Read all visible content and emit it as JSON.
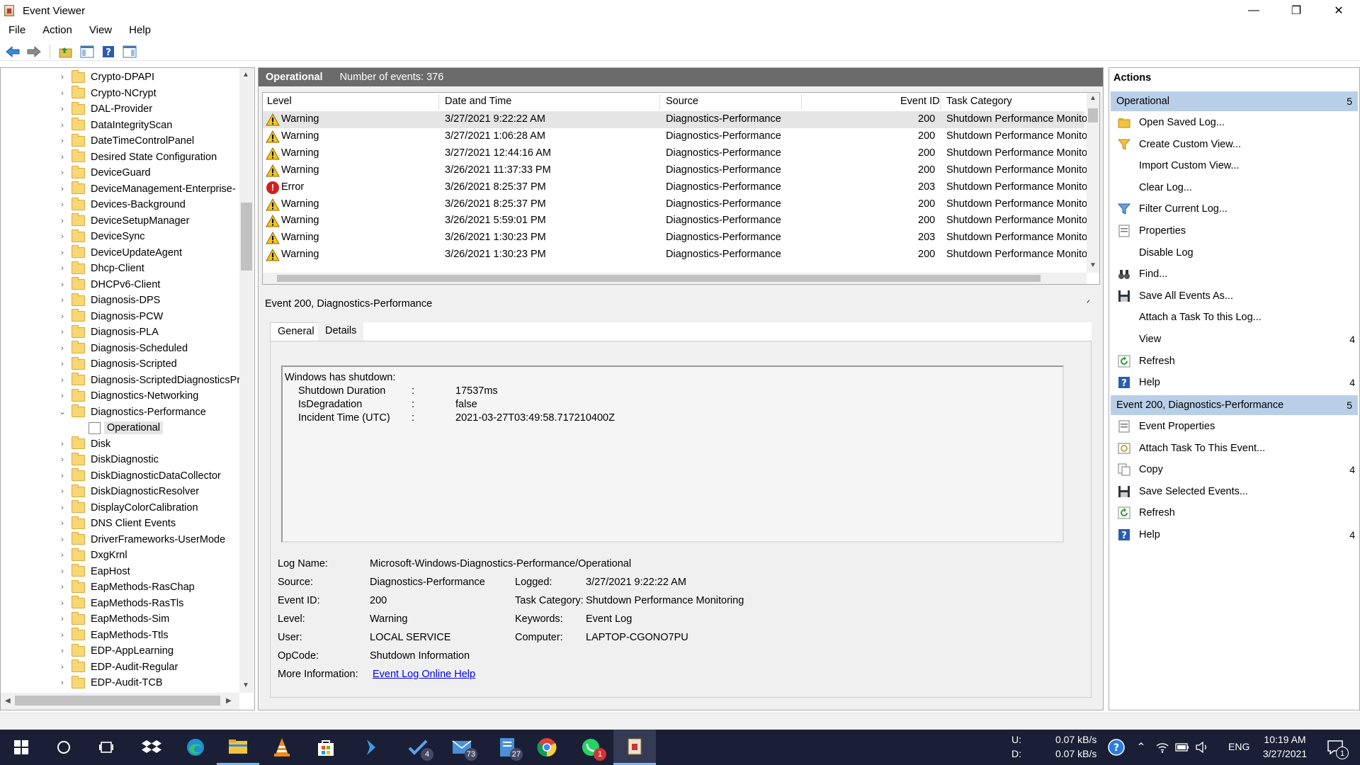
{
  "window": {
    "title": "Event Viewer",
    "minimize": "—",
    "restore": "❐",
    "close": "✕"
  },
  "menu": [
    "File",
    "Action",
    "View",
    "Help"
  ],
  "tree": {
    "items": [
      {
        "label": "Crypto-DPAPI",
        "expand": "›"
      },
      {
        "label": "Crypto-NCrypt",
        "expand": "›"
      },
      {
        "label": "DAL-Provider",
        "expand": "›"
      },
      {
        "label": "DataIntegrityScan",
        "expand": "›"
      },
      {
        "label": "DateTimeControlPanel",
        "expand": "›"
      },
      {
        "label": "Desired State Configuration",
        "expand": "›"
      },
      {
        "label": "DeviceGuard",
        "expand": "›"
      },
      {
        "label": "DeviceManagement-Enterprise-",
        "expand": "›"
      },
      {
        "label": "Devices-Background",
        "expand": "›"
      },
      {
        "label": "DeviceSetupManager",
        "expand": "›"
      },
      {
        "label": "DeviceSync",
        "expand": "›"
      },
      {
        "label": "DeviceUpdateAgent",
        "expand": "›"
      },
      {
        "label": "Dhcp-Client",
        "expand": "›"
      },
      {
        "label": "DHCPv6-Client",
        "expand": "›"
      },
      {
        "label": "Diagnosis-DPS",
        "expand": "›"
      },
      {
        "label": "Diagnosis-PCW",
        "expand": "›"
      },
      {
        "label": "Diagnosis-PLA",
        "expand": "›"
      },
      {
        "label": "Diagnosis-Scheduled",
        "expand": "›"
      },
      {
        "label": "Diagnosis-Scripted",
        "expand": "›"
      },
      {
        "label": "Diagnosis-ScriptedDiagnosticsPr",
        "expand": "›"
      },
      {
        "label": "Diagnostics-Networking",
        "expand": "›"
      },
      {
        "label": "Diagnostics-Performance",
        "expand": "⌄"
      },
      {
        "label": "Operational",
        "expand": ""
      },
      {
        "label": "Disk",
        "expand": "›"
      },
      {
        "label": "DiskDiagnostic",
        "expand": "›"
      },
      {
        "label": "DiskDiagnosticDataCollector",
        "expand": "›"
      },
      {
        "label": "DiskDiagnosticResolver",
        "expand": "›"
      },
      {
        "label": "DisplayColorCalibration",
        "expand": "›"
      },
      {
        "label": "DNS Client Events",
        "expand": "›"
      },
      {
        "label": "DriverFrameworks-UserMode",
        "expand": "›"
      },
      {
        "label": "DxgKrnl",
        "expand": "›"
      },
      {
        "label": "EapHost",
        "expand": "›"
      },
      {
        "label": "EapMethods-RasChap",
        "expand": "›"
      },
      {
        "label": "EapMethods-RasTls",
        "expand": "›"
      },
      {
        "label": "EapMethods-Sim",
        "expand": "›"
      },
      {
        "label": "EapMethods-Ttls",
        "expand": "›"
      },
      {
        "label": "EDP-AppLearning",
        "expand": "›"
      },
      {
        "label": "EDP-Audit-Regular",
        "expand": "›"
      },
      {
        "label": "EDP-Audit-TCB",
        "expand": "›"
      }
    ]
  },
  "log": {
    "name": "Operational",
    "count_text": "Number of events: 376"
  },
  "columns": {
    "level": "Level",
    "datetime": "Date and Time",
    "source": "Source",
    "eventid": "Event ID",
    "category": "Task Category"
  },
  "events": [
    {
      "level": "Warning",
      "icon": "warning-icon",
      "datetime": "3/27/2021 9:22:22 AM",
      "source": "Diagnostics-Performance",
      "eventid": "200",
      "category": "Shutdown Performance Monito"
    },
    {
      "level": "Warning",
      "icon": "warning-icon",
      "datetime": "3/27/2021 1:06:28 AM",
      "source": "Diagnostics-Performance",
      "eventid": "200",
      "category": "Shutdown Performance Monito"
    },
    {
      "level": "Warning",
      "icon": "warning-icon",
      "datetime": "3/27/2021 12:44:16 AM",
      "source": "Diagnostics-Performance",
      "eventid": "200",
      "category": "Shutdown Performance Monito"
    },
    {
      "level": "Warning",
      "icon": "warning-icon",
      "datetime": "3/26/2021 11:37:33 PM",
      "source": "Diagnostics-Performance",
      "eventid": "200",
      "category": "Shutdown Performance Monito"
    },
    {
      "level": "Error",
      "icon": "error-icon",
      "datetime": "3/26/2021 8:25:37 PM",
      "source": "Diagnostics-Performance",
      "eventid": "203",
      "category": "Shutdown Performance Monito"
    },
    {
      "level": "Warning",
      "icon": "warning-icon",
      "datetime": "3/26/2021 8:25:37 PM",
      "source": "Diagnostics-Performance",
      "eventid": "200",
      "category": "Shutdown Performance Monito"
    },
    {
      "level": "Warning",
      "icon": "warning-icon",
      "datetime": "3/26/2021 5:59:01 PM",
      "source": "Diagnostics-Performance",
      "eventid": "200",
      "category": "Shutdown Performance Monito"
    },
    {
      "level": "Warning",
      "icon": "warning-icon",
      "datetime": "3/26/2021 1:30:23 PM",
      "source": "Diagnostics-Performance",
      "eventid": "203",
      "category": "Shutdown Performance Monito"
    },
    {
      "level": "Warning",
      "icon": "warning-icon",
      "datetime": "3/26/2021 1:30:23 PM",
      "source": "Diagnostics-Performance",
      "eventid": "200",
      "category": "Shutdown Performance Monito"
    }
  ],
  "detail": {
    "title": "Event 200, Diagnostics-Performance",
    "tabs": [
      "General",
      "Details"
    ],
    "description": {
      "heading": "Windows has shutdown:",
      "rows": [
        {
          "key": "Shutdown Duration",
          "sep": ":",
          "value": "17537ms"
        },
        {
          "key": "IsDegradation",
          "sep": ":",
          "value": "false"
        },
        {
          "key": "Incident Time (UTC)",
          "sep": ":",
          "value": "2021-03-27T03:49:58.717210400Z"
        }
      ]
    },
    "props": {
      "log_name_label": "Log Name:",
      "log_name": "Microsoft-Windows-Diagnostics-Performance/Operational",
      "source_label": "Source:",
      "source": "Diagnostics-Performance",
      "logged_label": "Logged:",
      "logged": "3/27/2021 9:22:22 AM",
      "event_id_label": "Event ID:",
      "event_id": "200",
      "task_category_label": "Task Category:",
      "task_category": "Shutdown Performance Monitoring",
      "level_label": "Level:",
      "level": "Warning",
      "keywords_label": "Keywords:",
      "keywords": "Event Log",
      "user_label": "User:",
      "user": "LOCAL SERVICE",
      "computer_label": "Computer:",
      "computer": "LAPTOP-CGONO7PU",
      "opcode_label": "OpCode:",
      "opcode": "Shutdown Information",
      "more_info_label": "More Information:",
      "more_info_link": "Event Log Online Help"
    }
  },
  "actions": {
    "title": "Actions",
    "section1": {
      "label": "Operational",
      "arrow": "5"
    },
    "items1": [
      {
        "label": "Open Saved Log...",
        "icon": "folder-open-icon",
        "arrow": ""
      },
      {
        "label": "Create Custom View...",
        "icon": "funnel-star-icon",
        "arrow": ""
      },
      {
        "label": "Import Custom View...",
        "icon": "",
        "arrow": ""
      },
      {
        "label": "Clear Log...",
        "icon": "",
        "arrow": ""
      },
      {
        "label": "Filter Current Log...",
        "icon": "funnel-icon",
        "arrow": ""
      },
      {
        "label": "Properties",
        "icon": "properties-icon",
        "arrow": ""
      },
      {
        "label": "Disable Log",
        "icon": "",
        "arrow": ""
      },
      {
        "label": "Find...",
        "icon": "binoculars-icon",
        "arrow": ""
      },
      {
        "label": "Save All Events As...",
        "icon": "save-icon",
        "arrow": ""
      },
      {
        "label": "Attach a Task To this Log...",
        "icon": "",
        "arrow": ""
      },
      {
        "label": "View",
        "icon": "",
        "arrow": "4"
      },
      {
        "label": "Refresh",
        "icon": "refresh-icon",
        "arrow": ""
      },
      {
        "label": "Help",
        "icon": "help-icon",
        "arrow": "4"
      }
    ],
    "section2": {
      "label": "Event 200, Diagnostics-Performance",
      "arrow": "5"
    },
    "items2": [
      {
        "label": "Event Properties",
        "icon": "event-properties-icon",
        "arrow": ""
      },
      {
        "label": "Attach Task To This Event...",
        "icon": "task-icon",
        "arrow": ""
      },
      {
        "label": "Copy",
        "icon": "copy-icon",
        "arrow": "4"
      },
      {
        "label": "Save Selected Events...",
        "icon": "save-icon",
        "arrow": ""
      },
      {
        "label": "Refresh",
        "icon": "refresh-icon",
        "arrow": ""
      },
      {
        "label": "Help",
        "icon": "help-icon",
        "arrow": "4"
      }
    ]
  },
  "taskbar": {
    "badges": {
      "todo": "4",
      "mail": "73",
      "files": "27",
      "whatsapp": "1"
    },
    "net": {
      "up_label": "U:",
      "down_label": "D:",
      "up": "0.07 kB/s",
      "down": "0.07 kB/s"
    },
    "lang": "ENG",
    "time": "10:19 AM",
    "date": "3/27/2021",
    "notif_count": "1"
  },
  "colors": {
    "accent": "#b9cfe8",
    "header_gray": "#6b6b6b",
    "taskbar": "#1b1f36",
    "link": "#0000ee"
  }
}
